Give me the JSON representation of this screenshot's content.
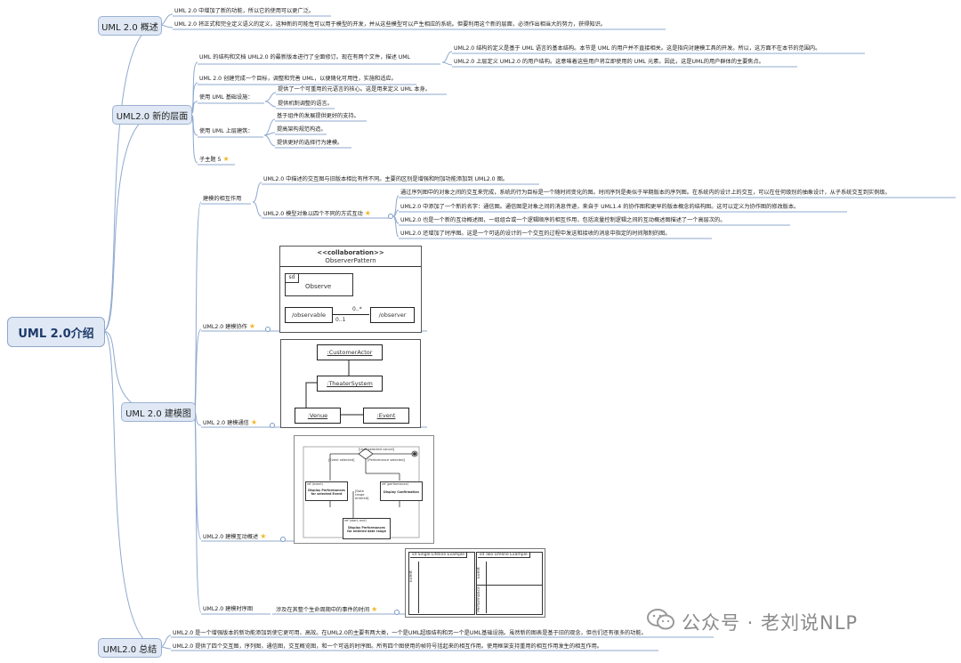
{
  "root": {
    "label": "UML 2.0介绍"
  },
  "overview": {
    "label": "UML 2.0 概述",
    "items": [
      "UML 2.0 中增加了新的功能，所以它的使用可以更广泛。",
      "UML 2.0 将正式和完全定义语义的定义，这种新的可能性可以用于模型的开发，并从这些模型可以产生相应的系统。但要利用这个新的层面，必须作出相当大的努力，获得知识。"
    ]
  },
  "new_layers": {
    "label": "UML2.0 新的层面",
    "restructure": "UML 的结构和文档 UML2.0 的最新版本进行了全面修订。现在有两个文件，描述 UML",
    "restructure_sub": [
      "UML2.0 结构的定义是基于 UML 语言的基本结构。本节是 UML 的用户并不直接相关。这是指向对建模工具的开发。所以，这方面不在本节的范围内。",
      "UML2.0 上层定义 UML2.0 的用户结构。这意味着这些用户将立即使用的 UML 元素。因此，这是UML的用户群体的主要焦点。"
    ],
    "goal": "UML 2.0 创建完成一个目标，调整和完善 UML，以便随化可用性，实施和适应。",
    "infra_label": "使用 UML 基础设施：",
    "infra_items": [
      "提供了一个可重用的元语言的核心。这是用来定义 UML 本身。",
      "提供机制调整的语言。"
    ],
    "super_label": "使用 UML 上层建筑：",
    "super_items": [
      "基于组件的发展提供更好的支持。",
      "提高架构规范构造。",
      "提供更好的选择行为建模。"
    ],
    "subtopic": "子主题 5"
  },
  "modeling": {
    "label": "UML 2.0 建模图",
    "interaction_label": "建模的相互作用",
    "interaction_note": "UML2.0 中描述的交互图与旧版本相比有所不同。主要的区别是增强和附加功能添加到 UML2.0 图。",
    "four_ways_label": "UML2.0 模型对象以四个不同的方式互动",
    "four_ways": [
      "通过序列图中的对象之间的交互来完成，系统的行为目标是一个随时间变化的图。时间序列是类似于早期版本的序列图。在系统内的设计上的交互，可以在任何级别的抽象设计，从子系统交互到实例级。",
      "UML2.0 中添加了一个新的名字：通信图。通信图是对象之间的消息传递，来自于 UML1.4 的协作图和更早的版本概念的结构图。这可以定义为协作图的修改版本。",
      "UML2.0 也是一个新的互动概述图，一组组合或一个逻辑顺序的相互作用，包括流量控制逻辑之间的互动概述图描述了一个高层次的。",
      "UML2.0 还增加了时序图。这是一个可选的设计的一个交互的过程中发送和接收的消息中指定的时间限制的图。"
    ],
    "collab_label": "UML2.0 建模协作",
    "comm_label": "UML 2.0 建模通信",
    "overview_label": "UML2.0 建模互动概述",
    "timing_label": "UML2.0 建模时序图",
    "timing_note": "涉及在其整个生命周期中的事件的时间"
  },
  "collab_diagram": {
    "stereotype": "<<collaboration>>",
    "name": "ObserverPattern",
    "sd_tag": "sd",
    "sd_name": "Observe",
    "left_role": "/observable",
    "right_role": "/observer",
    "mult_top": "0..*",
    "mult_bottom": "0..1"
  },
  "comm_diagram": {
    "actor": ":CustomerActor",
    "system": ":TheaterSystem",
    "venue": ":Venue",
    "event": ":Event"
  },
  "overview_diagram": {
    "guard_user": "[User selected cancel]",
    "guard_event": "[Event selected]",
    "guard_perf": "[Performance selected]",
    "guard_date": "[Date range entered]",
    "ref_event_tag": "ref (event)",
    "ref_event": "Display Performances for selected Event",
    "ref_perf_tag": "ref (performance)",
    "ref_perf": "Display Confirmation",
    "ref_date_tag": "ref (start, end)",
    "ref_date": "Display Performances for entered date range"
  },
  "timing_diagram": {
    "single": "sd Single Lifeline Example",
    "two": "sd Two Lifeline Example",
    "lane_event": "Event",
    "lane_event2": "Event",
    "lane_perf": "Performance"
  },
  "summary": {
    "label": "UML2.0 总结",
    "items": [
      "UML2.0 是一个增强版本的新功能添加到使它更可用、高效。在UML2.0的主要有两大类，一个是UML超级结构和另一个是UML基础设施。虽然新的图表是基于旧的观念，但也们还有很多的功能。",
      "UML2.0 提供了四个交互图，序列图，通信图，交互概览图，和一个可选的时序图。所有四个图使用的帧符号括起来的相互作用。使用框架支持重用的相互作用发生的相互作用。"
    ]
  },
  "watermark": "公众号 · 老刘说NLP"
}
